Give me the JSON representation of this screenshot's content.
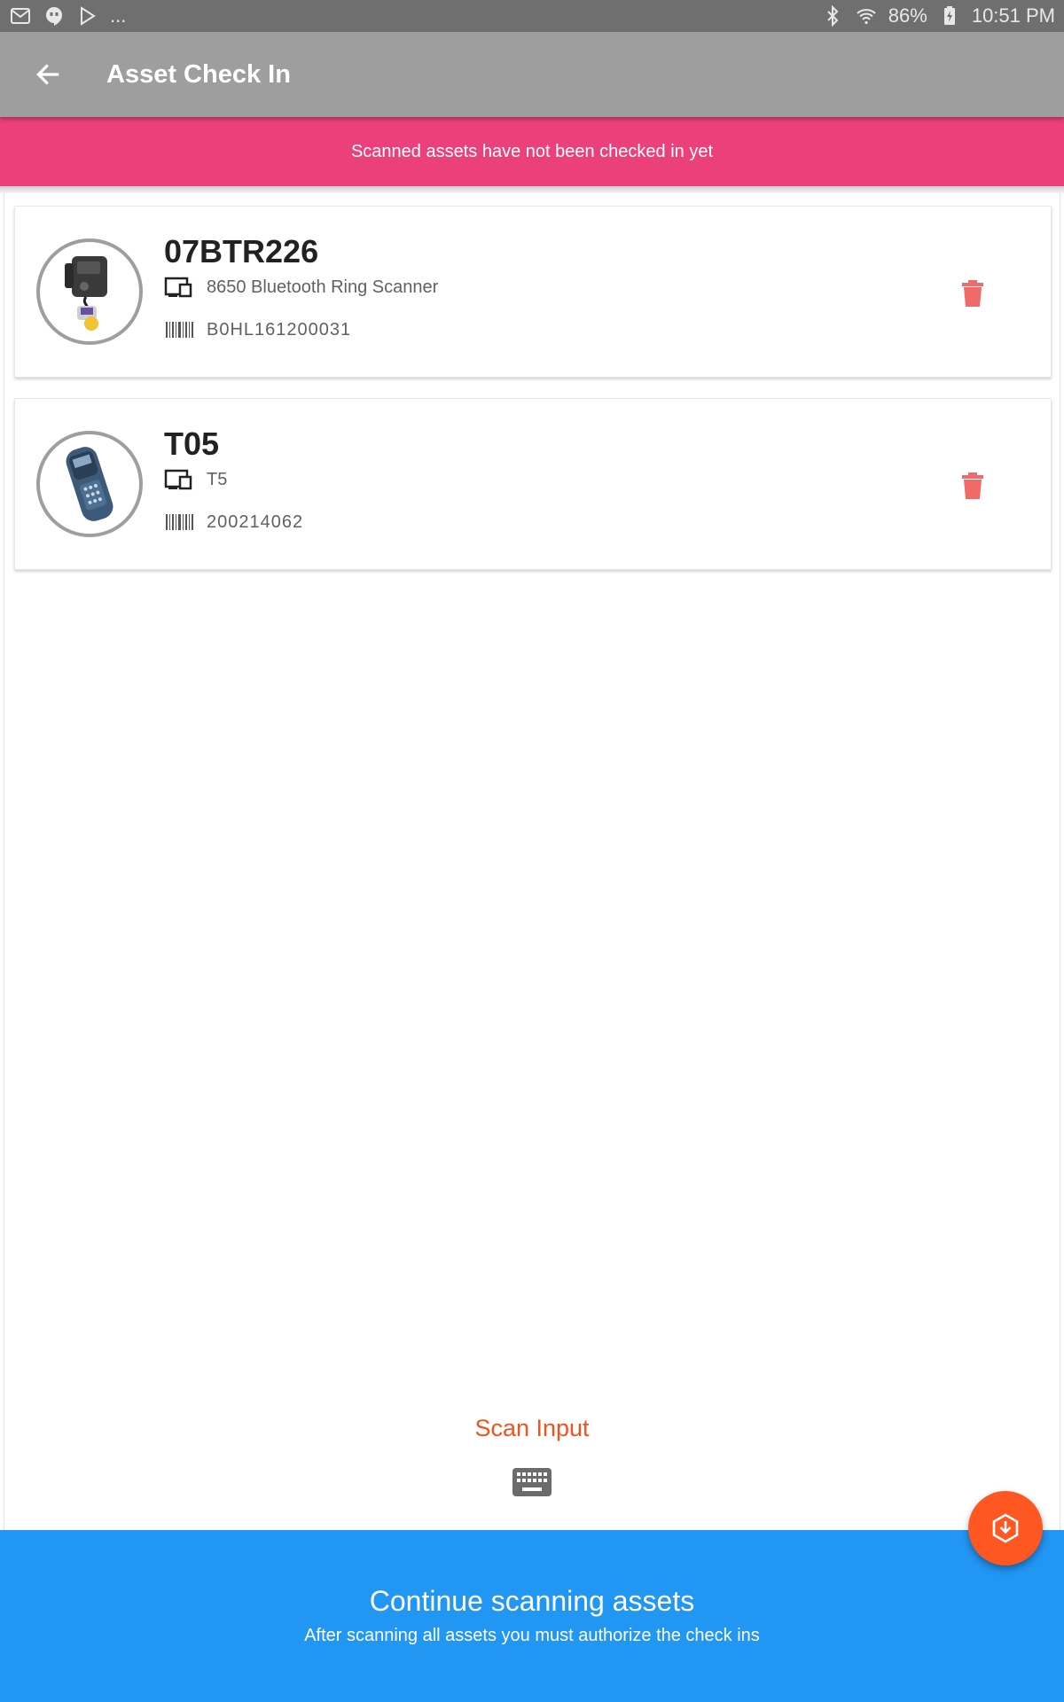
{
  "status_bar": {
    "notification_icons": [
      "gmail-icon",
      "hangouts-icon",
      "play-store-icon"
    ],
    "overflow": "...",
    "battery": "86%",
    "time": "10:51 PM"
  },
  "app_bar": {
    "title": "Asset Check In",
    "back_icon": "arrow-back-icon"
  },
  "banner": {
    "text": "Scanned assets have not been checked in yet",
    "color": "#ec407a"
  },
  "assets": [
    {
      "name": "07BTR226",
      "model": "8650 Bluetooth Ring Scanner",
      "serial": "B0HL161200031",
      "image": "ring-scanner-image"
    },
    {
      "name": "T05",
      "model": "T5",
      "serial": "200214062",
      "image": "handheld-scanner-image"
    }
  ],
  "scan_input": {
    "label": "Scan Input",
    "icon": "keyboard-icon"
  },
  "bottom_bar": {
    "title": "Continue scanning assets",
    "subtitle": "After scanning all assets you must authorize the check ins",
    "color": "#2196f3"
  },
  "fab": {
    "icon": "scan-down-icon",
    "color": "#ff5722"
  },
  "colors": {
    "app_bar": "#9e9e9e",
    "accent": "#f4511e",
    "delete": "#f06a6a"
  }
}
